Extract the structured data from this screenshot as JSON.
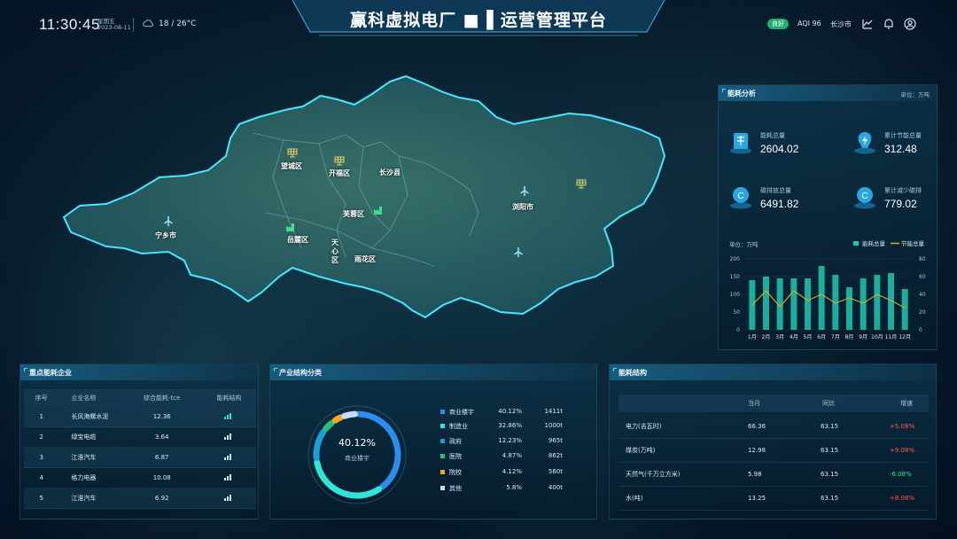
{
  "header": {
    "time": "11:30:45",
    "weekday": "星期五",
    "date": "2023-08-11",
    "weather": "18 / 26°C",
    "title": "赢科虚拟电厂 ■ ▌运营管理平台",
    "badge": "良好",
    "aqi": "AQI 96",
    "city": "长沙市",
    "icons": [
      "chart-icon",
      "bell-icon",
      "user-icon"
    ]
  },
  "map": {
    "labels": [
      {
        "text": "望城区"
      },
      {
        "text": "开福区"
      },
      {
        "text": "长沙县"
      },
      {
        "text": "芙蓉区"
      },
      {
        "text": "岳麓区"
      },
      {
        "text": "天心区"
      },
      {
        "text": "雨花区"
      },
      {
        "text": "浏阳市"
      },
      {
        "text": "宁乡市"
      }
    ]
  },
  "energy_analysis": {
    "title": "能耗分析",
    "unit": "单位：万吨",
    "stats": [
      {
        "label": "能耗总量",
        "value": "2604.02",
        "icon": "building-icon"
      },
      {
        "label": "累计节能总量",
        "value": "312.48",
        "icon": "bolt-icon"
      },
      {
        "label": "碳排放总量",
        "value": "6491.82",
        "icon": "carbon-icon"
      },
      {
        "label": "累计减少碳排",
        "value": "779.02",
        "icon": "carbon-reduce-icon"
      }
    ]
  },
  "chart_data": {
    "type": "bar",
    "title": "",
    "ylabel": "单位：万吨",
    "categories": [
      "1月",
      "2月",
      "3月",
      "4月",
      "5月",
      "6月",
      "7月",
      "8月",
      "9月",
      "10月",
      "11月",
      "12月"
    ],
    "ylim": [
      0,
      200
    ],
    "y2lim": [
      0,
      80
    ],
    "yticks": [
      "200",
      "150",
      "100",
      "50",
      "0"
    ],
    "y2ticks": [
      "80",
      "60",
      "40",
      "20",
      "0"
    ],
    "series": [
      {
        "name": "能耗总量",
        "type": "bar",
        "color": "#1fc7b0",
        "values": [
          140,
          150,
          145,
          145,
          145,
          180,
          155,
          120,
          145,
          155,
          160,
          115
        ]
      },
      {
        "name": "节能总量",
        "type": "line",
        "color": "#d9a72a",
        "axis": "right",
        "values": [
          28,
          44,
          26,
          44,
          33,
          40,
          30,
          36,
          30,
          40,
          33,
          25
        ]
      }
    ],
    "legend_position": "top-right",
    "grid": true
  },
  "key_enterprises": {
    "title": "重点能耗企业",
    "columns": [
      "序号",
      "企业名称",
      "综合能耗-tce",
      "能耗结构"
    ],
    "rows": [
      {
        "no": "1",
        "name": "长风海螺水泥",
        "value": "12.36"
      },
      {
        "no": "2",
        "name": "绿宝电缆",
        "value": "3.64"
      },
      {
        "no": "3",
        "name": "江淮汽车",
        "value": "6.87"
      },
      {
        "no": "4",
        "name": "格力电器",
        "value": "10.08"
      },
      {
        "no": "5",
        "name": "江淮汽车",
        "value": "6.92"
      }
    ]
  },
  "industry": {
    "title": "产业结构分类",
    "center_value": "40.12%",
    "center_label": "商业楼宇",
    "items": [
      {
        "name": "商业楼宇",
        "percent": "40.12%",
        "value": "1411t",
        "color": "#2d8cf0"
      },
      {
        "name": "制造业",
        "percent": "32.86%",
        "value": "1000t",
        "color": "#2ee6d6"
      },
      {
        "name": "政府",
        "percent": "12.23%",
        "value": "965t",
        "color": "#1a9fd4"
      },
      {
        "name": "医院",
        "percent": "4.87%",
        "value": "862t",
        "color": "#27c07a"
      },
      {
        "name": "院校",
        "percent": "4.12%",
        "value": "560t",
        "color": "#f2a62b"
      },
      {
        "name": "其他",
        "percent": "5.8%",
        "value": "400t",
        "color": "#c9dcff"
      }
    ]
  },
  "energy_structure": {
    "title": "能耗结构",
    "columns": [
      "当月",
      "同比",
      "增速"
    ],
    "rows": [
      {
        "name": "电力(吉瓦时)",
        "current": "66.36",
        "yoy": "63.15",
        "growth": "+5.08%",
        "color": "#ff5a4e"
      },
      {
        "name": "煤炭(万吨)",
        "current": "12.98",
        "yoy": "63.15",
        "growth": "+9.08%",
        "color": "#ff5a4e"
      },
      {
        "name": "天然气(千万立方米)",
        "current": "5.98",
        "yoy": "63.15",
        "growth": "-6.08%",
        "color": "#3fe08a"
      },
      {
        "name": "水(吨)",
        "current": "13.25",
        "yoy": "63.15",
        "growth": "+8.08%",
        "color": "#ff5a4e"
      }
    ]
  }
}
